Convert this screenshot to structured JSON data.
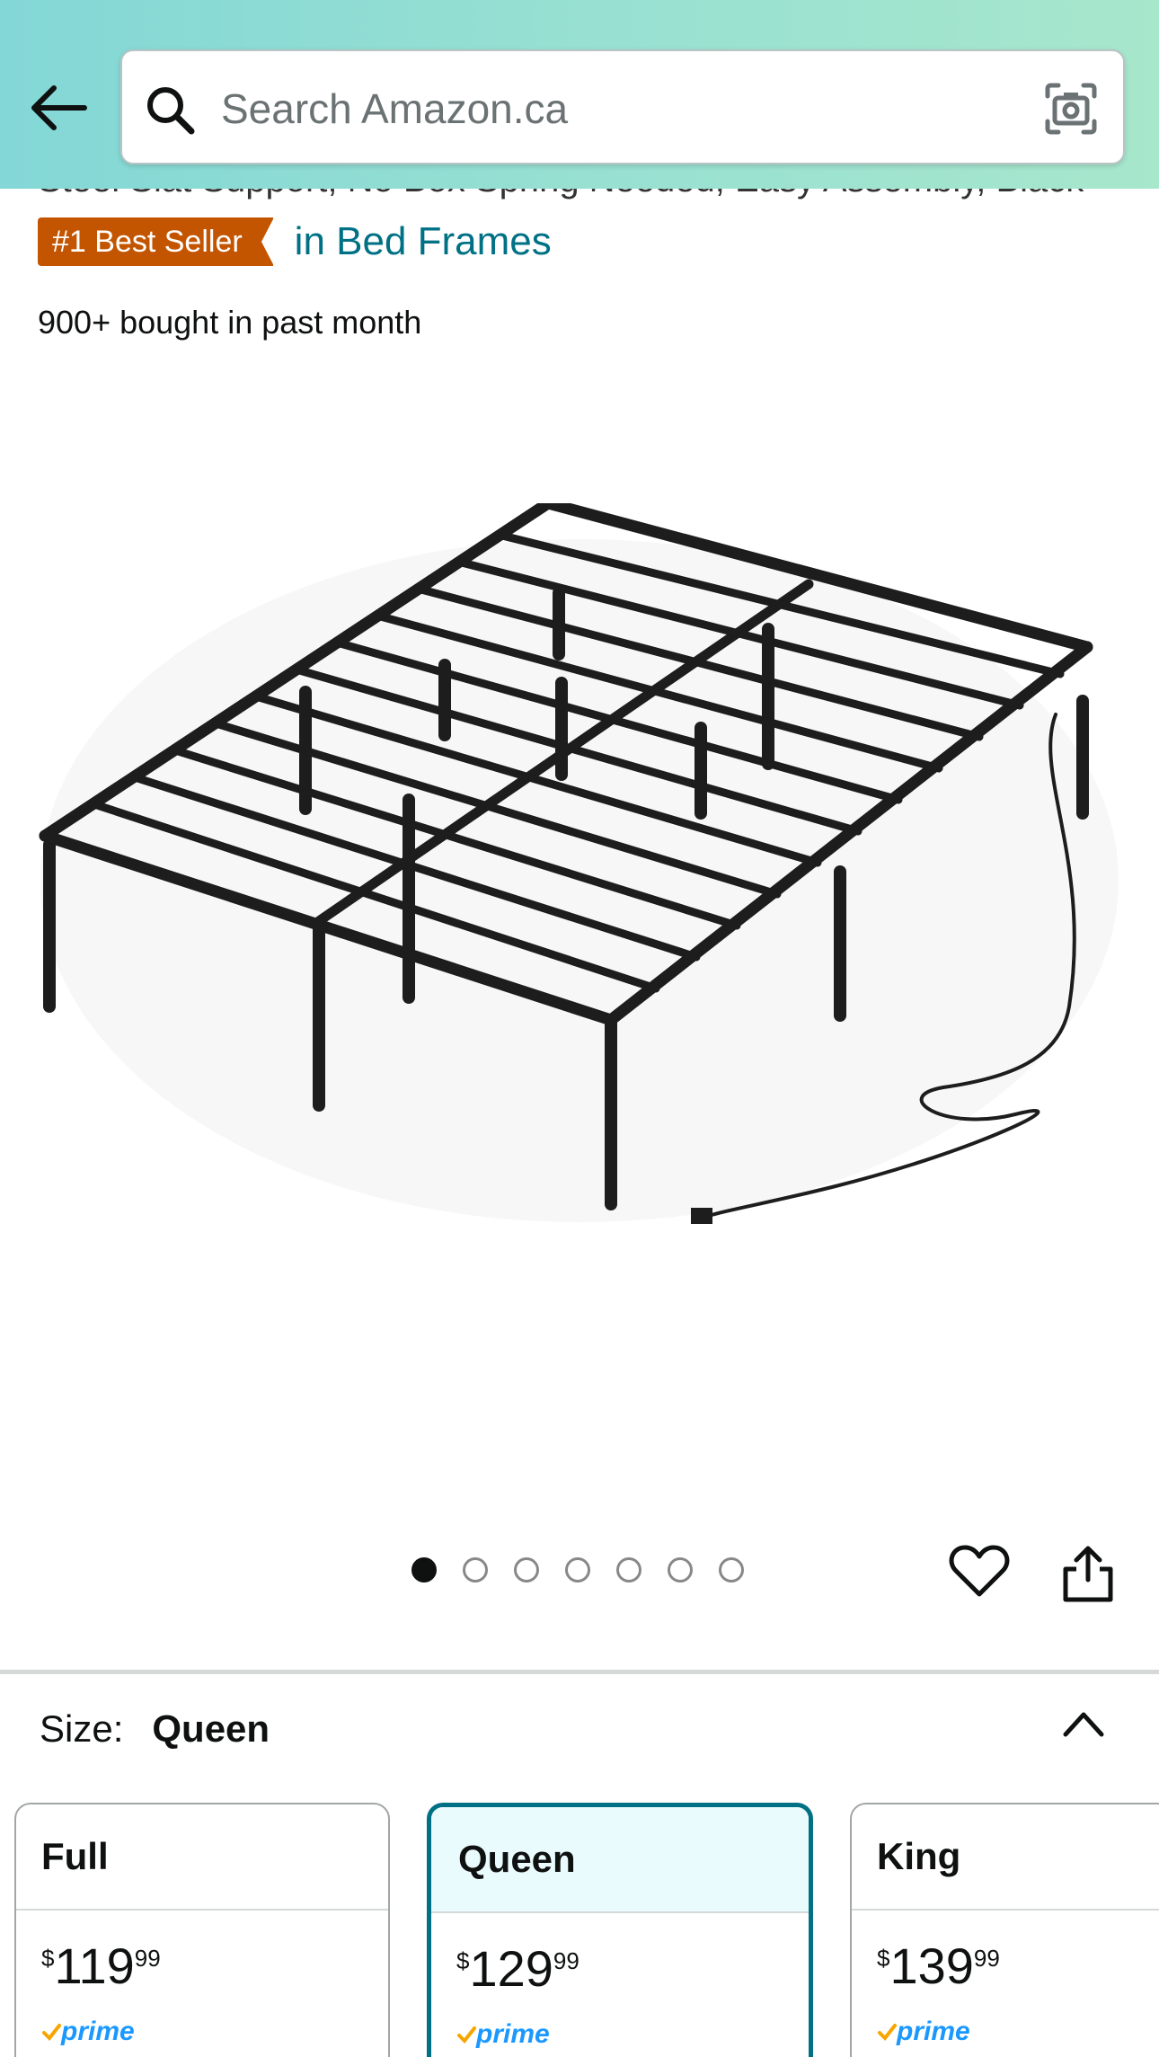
{
  "header": {
    "search_placeholder": "Search Amazon.ca"
  },
  "product": {
    "title_fragment": "Steel Slat Support, No Box Spring Needed, Easy Assembly, Black",
    "badge": "#1 Best Seller",
    "category_link": "in Bed Frames",
    "bought": "900+ bought in past month",
    "image_count": 7,
    "active_image_index": 0
  },
  "size": {
    "label": "Size:",
    "selected": "Queen",
    "options": [
      {
        "name": "Full",
        "currency": "$",
        "whole": "119",
        "fraction": "99",
        "prime": "prime"
      },
      {
        "name": "Queen",
        "currency": "$",
        "whole": "129",
        "fraction": "99",
        "prime": "prime"
      },
      {
        "name": "King",
        "currency": "$",
        "whole": "139",
        "fraction": "99",
        "prime": "prime"
      }
    ]
  },
  "colors": {
    "header_gradient_start": "#83d7d6",
    "header_gradient_end": "#a7e7cc",
    "badge": "#c45500",
    "link": "#007185",
    "prime": "#1a98ff",
    "selected_border": "#007185"
  },
  "icons": {
    "back": "back-arrow-icon",
    "search": "search-icon",
    "camera": "camera-icon",
    "heart": "heart-icon",
    "share": "share-icon",
    "collapse": "chevron-up-icon"
  }
}
